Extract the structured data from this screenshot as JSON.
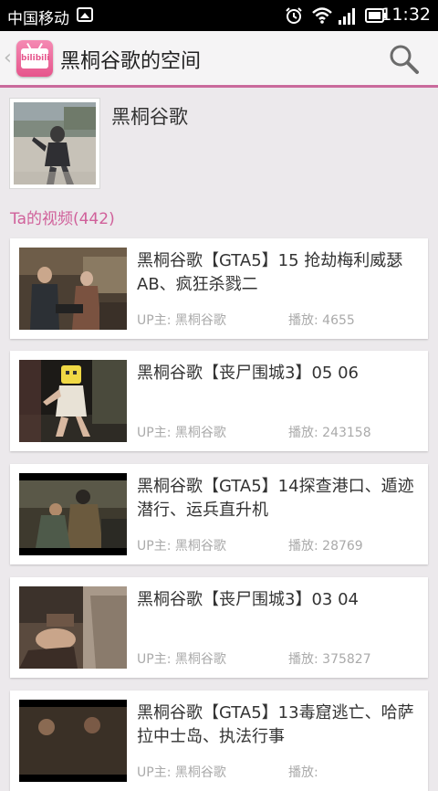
{
  "status_bar": {
    "carrier": "中国移动",
    "time": "11:32"
  },
  "action_bar": {
    "title": "黑桐谷歌的空间",
    "logo_text": "bilibili"
  },
  "profile": {
    "name": "黑桐谷歌"
  },
  "videos_section": {
    "title": "Ta的视频(442)"
  },
  "videos": [
    {
      "title": "黑桐谷歌【GTA5】15 抢劫梅利威瑟AB、疯狂杀戮二",
      "uploader": "UP主: 黑桐谷歌",
      "plays": "播放: 4655"
    },
    {
      "title": "黑桐谷歌【丧尸围城3】05 06",
      "uploader": "UP主: 黑桐谷歌",
      "plays": "播放: 243158"
    },
    {
      "title": "黑桐谷歌【GTA5】14探查港口、遁迹潜行、运兵直升机",
      "uploader": "UP主: 黑桐谷歌",
      "plays": "播放: 28769"
    },
    {
      "title": "黑桐谷歌【丧尸围城3】03 04",
      "uploader": "UP主: 黑桐谷歌",
      "plays": "播放: 375827"
    },
    {
      "title": "黑桐谷歌【GTA5】13毒窟逃亡、哈萨拉中士岛、执法行事",
      "uploader": "UP主: 黑桐谷歌",
      "plays": "播放:"
    }
  ],
  "colors": {
    "accent": "#d0609a",
    "action_bar_border": "#c96a9c",
    "background": "#ece9ec"
  }
}
